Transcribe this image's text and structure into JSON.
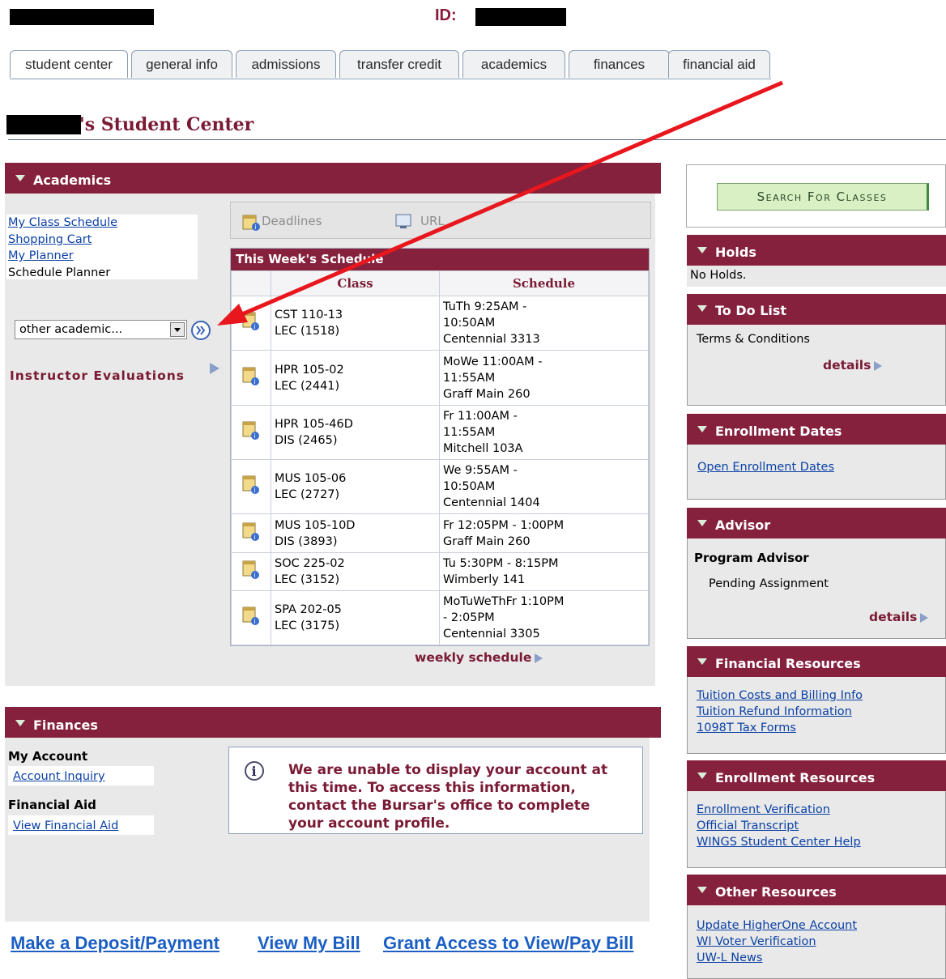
{
  "header": {
    "id_label": "ID:"
  },
  "tabs": [
    "student center",
    "general info",
    "admissions",
    "transfer credit",
    "academics",
    "finances",
    "financial aid"
  ],
  "page_title": "'s Student Center",
  "academics": {
    "title": "Academics",
    "links": [
      "My Class Schedule",
      "Shopping Cart",
      "My Planner"
    ],
    "plain_item": "Schedule Planner",
    "dropdown_value": "other academic...",
    "instructor_evaluations": "Instructor Evaluations",
    "deadlines_label": "Deadlines",
    "url_label": "URL",
    "schedule_title": "This Week's Schedule",
    "col_class": "Class",
    "col_schedule": "Schedule",
    "rows": [
      {
        "class_l1": "CST 110-13",
        "class_l2": "LEC (1518)",
        "sched_l1": "TuTh 9:25AM -",
        "sched_l2": "10:50AM",
        "sched_l3": "Centennial 3313"
      },
      {
        "class_l1": "HPR 105-02",
        "class_l2": "LEC (2441)",
        "sched_l1": "MoWe 11:00AM -",
        "sched_l2": "11:55AM",
        "sched_l3": "Graff Main 260"
      },
      {
        "class_l1": "HPR 105-46D",
        "class_l2": "DIS (2465)",
        "sched_l1": "Fr 11:00AM -",
        "sched_l2": "11:55AM",
        "sched_l3": "Mitchell 103A"
      },
      {
        "class_l1": "MUS 105-06",
        "class_l2": "LEC (2727)",
        "sched_l1": "We 9:55AM -",
        "sched_l2": "10:50AM",
        "sched_l3": "Centennial 1404"
      },
      {
        "class_l1": "MUS 105-10D",
        "class_l2": "DIS (3893)",
        "sched_l1": "Fr 12:05PM - 1:00PM",
        "sched_l2": "Graff Main 260",
        "sched_l3": ""
      },
      {
        "class_l1": "SOC 225-02",
        "class_l2": "LEC (3152)",
        "sched_l1": "Tu 5:30PM - 8:15PM",
        "sched_l2": "Wimberly 141",
        "sched_l3": ""
      },
      {
        "class_l1": "SPA 202-05",
        "class_l2": "LEC (3175)",
        "sched_l1": "MoTuWeThFr 1:10PM",
        "sched_l2": "- 2:05PM",
        "sched_l3": "Centennial 3305"
      }
    ],
    "weekly_schedule": "weekly schedule"
  },
  "finances": {
    "title": "Finances",
    "my_account": "My Account",
    "account_inquiry": "Account Inquiry",
    "financial_aid": "Financial Aid",
    "view_financial_aid": "View Financial Aid",
    "message_l1": "We are unable to display your account at",
    "message_l2": "this time.  To access this information,",
    "message_l3": "contact the Bursar's office to complete",
    "message_l4": "your account profile."
  },
  "bottom_links": [
    "Make a Deposit/Payment",
    "View My Bill",
    "Grant Access to View/Pay Bill"
  ],
  "right": {
    "search_button": "Search For Classes",
    "holds_title": "Holds",
    "holds_text": "No Holds.",
    "todo_title": "To Do List",
    "todo_item": "Terms & Conditions",
    "details": "details",
    "enroll_dates_title": "Enrollment Dates",
    "enroll_dates_link": "Open Enrollment Dates",
    "advisor_title": "Advisor",
    "advisor_label": "Program Advisor",
    "advisor_value": "Pending Assignment",
    "fin_res_title": "Financial Resources",
    "fin_res_links": [
      "Tuition Costs and Billing Info",
      "Tuition Refund Information",
      "1098T Tax Forms"
    ],
    "enroll_res_title": "Enrollment Resources",
    "enroll_res_links": [
      "Enrollment Verification",
      "Official Transcript",
      "WINGS Student Center Help"
    ],
    "other_res_title": "Other Resources",
    "other_res_links": [
      "Update HigherOne Account",
      "WI Voter Verification",
      "UW-L News"
    ]
  },
  "colors": {
    "maroon": "#85213d",
    "link": "#0b41a6",
    "panel": "#e9e9e9",
    "arrow": "#e8161d"
  }
}
